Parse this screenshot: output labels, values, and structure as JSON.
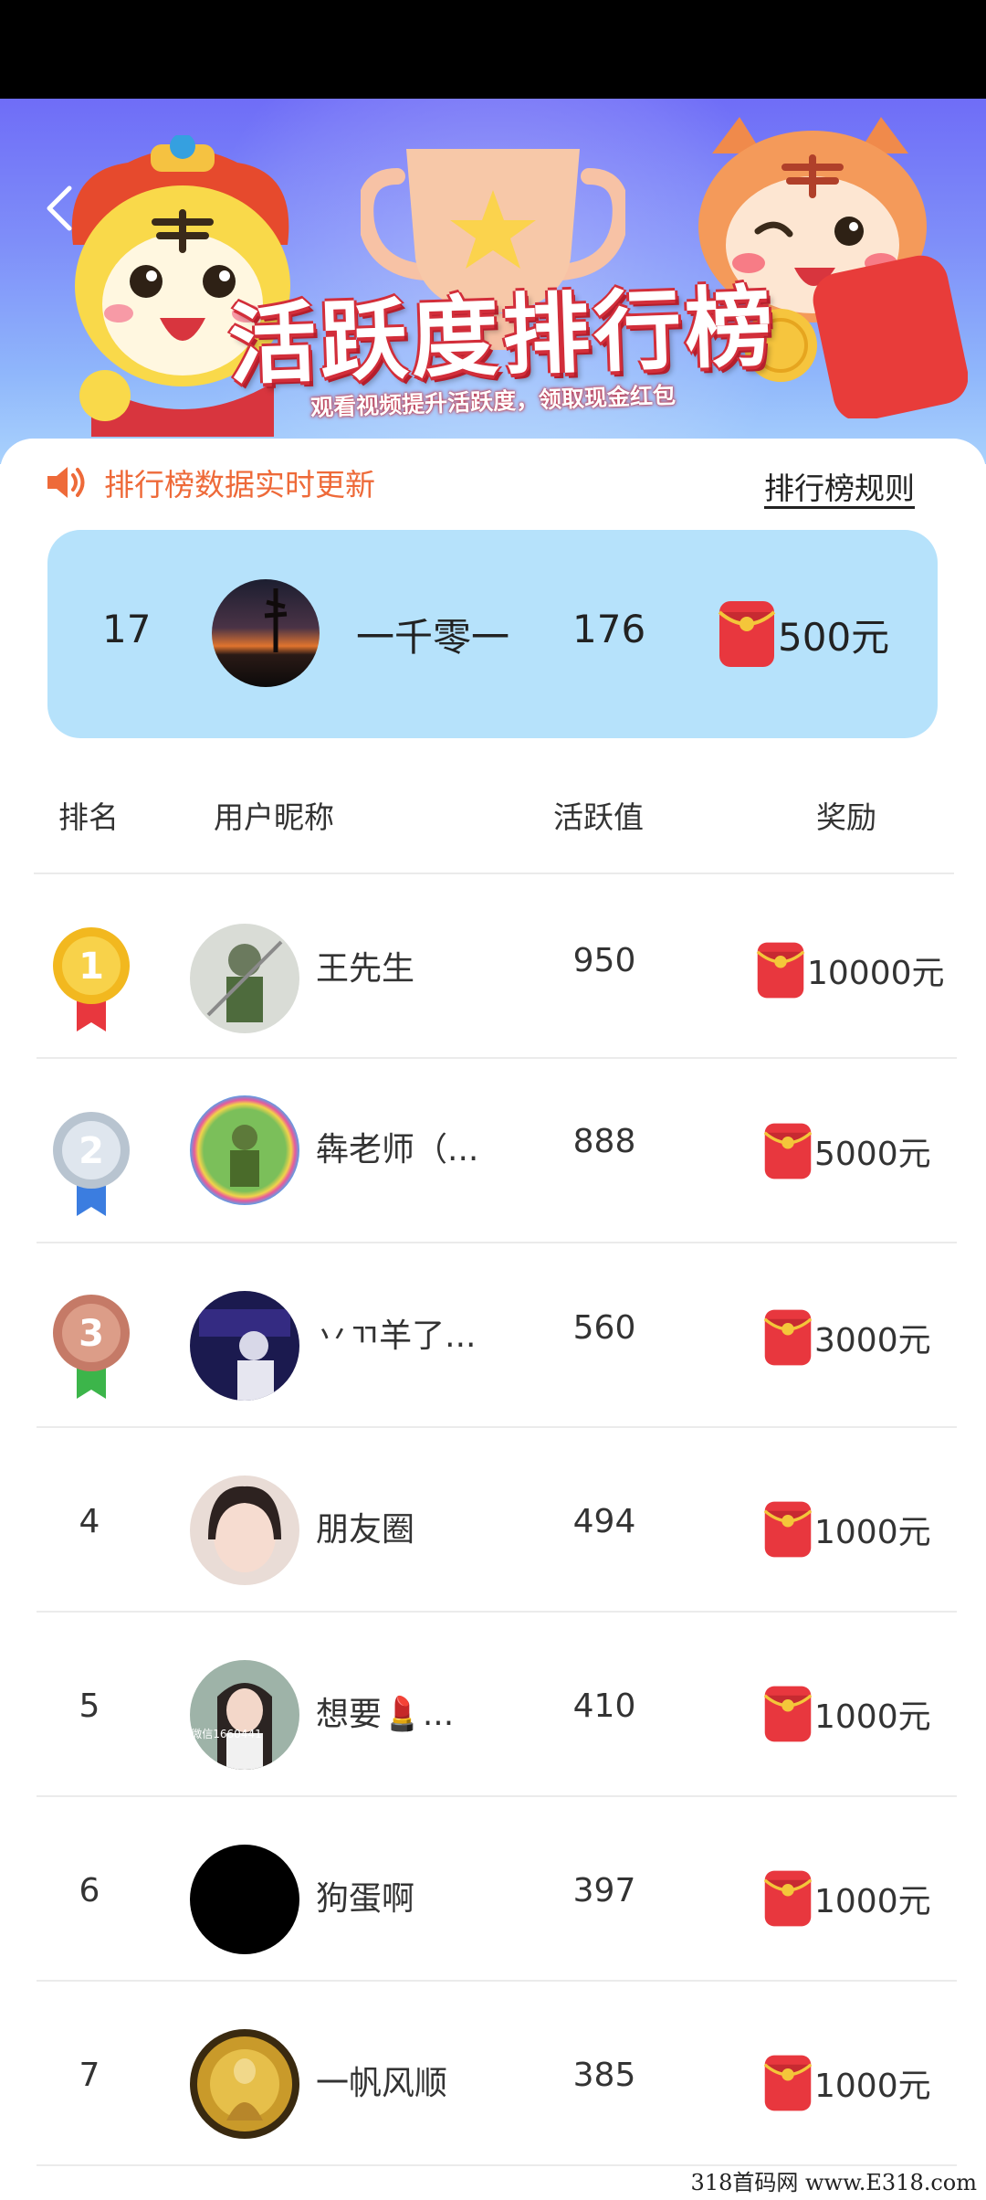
{
  "banner": {
    "title": "活跃度排行榜",
    "subtitle": "观看视频提升活跃度，领取现金红包",
    "back_icon": "chevron-left-icon"
  },
  "notice": {
    "icon": "speaker-icon",
    "text": "排行榜数据实时更新",
    "rules_link": "排行榜规则"
  },
  "my_rank": {
    "rank": "17",
    "name": "一千零一",
    "score": "176",
    "reward": "500元"
  },
  "table_headers": [
    "排名",
    "用户昵称",
    "活跃值",
    "奖励"
  ],
  "rows": [
    {
      "rank": "1",
      "name": "王先生",
      "score": "950",
      "reward": "10000元"
    },
    {
      "rank": "2",
      "name": "犇老师（...",
      "score": "888",
      "reward": "5000元"
    },
    {
      "rank": "3",
      "name": "丷ㄲ羊了...",
      "score": "560",
      "reward": "3000元"
    },
    {
      "rank": "4",
      "name": "朋友圈",
      "score": "494",
      "reward": "1000元"
    },
    {
      "rank": "5",
      "name": "想要💄...",
      "score": "410",
      "reward": "1000元"
    },
    {
      "rank": "6",
      "name": "狗蛋啊",
      "score": "397",
      "reward": "1000元"
    },
    {
      "rank": "7",
      "name": "一帆风顺",
      "score": "385",
      "reward": "1000元"
    }
  ],
  "avatar_overlay_text": "微信1660441",
  "watermark": "318首码网 www.E318.com",
  "colors": {
    "accent_orange": "#ee6a39",
    "card_blue": "#b6e2fb",
    "red_packet": "#e8373e",
    "gold": "#f4c63a"
  }
}
